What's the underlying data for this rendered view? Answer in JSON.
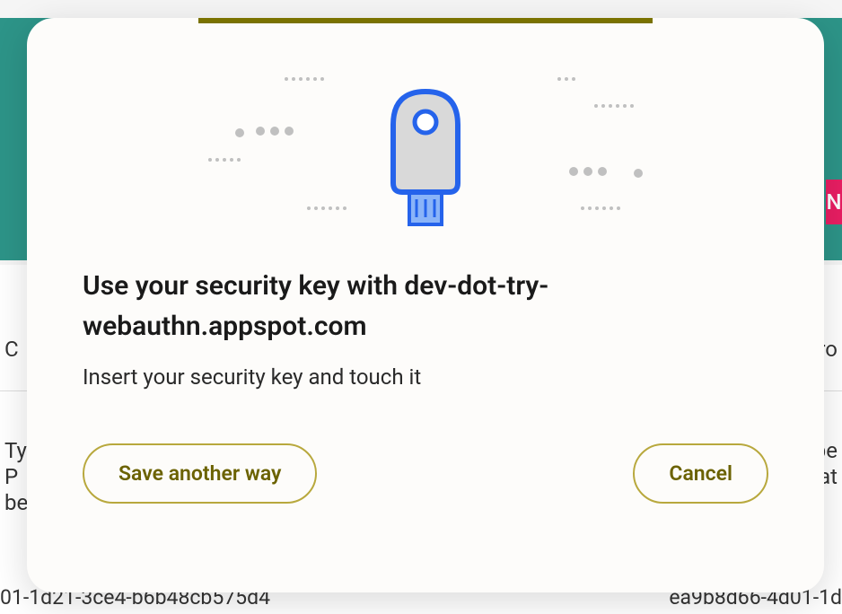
{
  "background": {
    "header_char_left": "C",
    "header_char_right": "ro",
    "left_text": "Ty\nP\nbe",
    "right_text": "pe\nat",
    "id_left": "01-1d21-3ce4-b6b48cb575d4",
    "id_right": "ea9b8d66-4d01-1d",
    "pink_char": "N"
  },
  "modal": {
    "title": "Use your security key with dev-dot-try-webauthn.appspot.com",
    "subtitle": "Insert your security key and touch it",
    "buttons": {
      "save_another": "Save another way",
      "cancel": "Cancel"
    }
  },
  "colors": {
    "accent": "#7a7200",
    "button_border": "#b8a83d",
    "key_outline": "#2563eb",
    "key_fill": "#d4d4d4"
  }
}
